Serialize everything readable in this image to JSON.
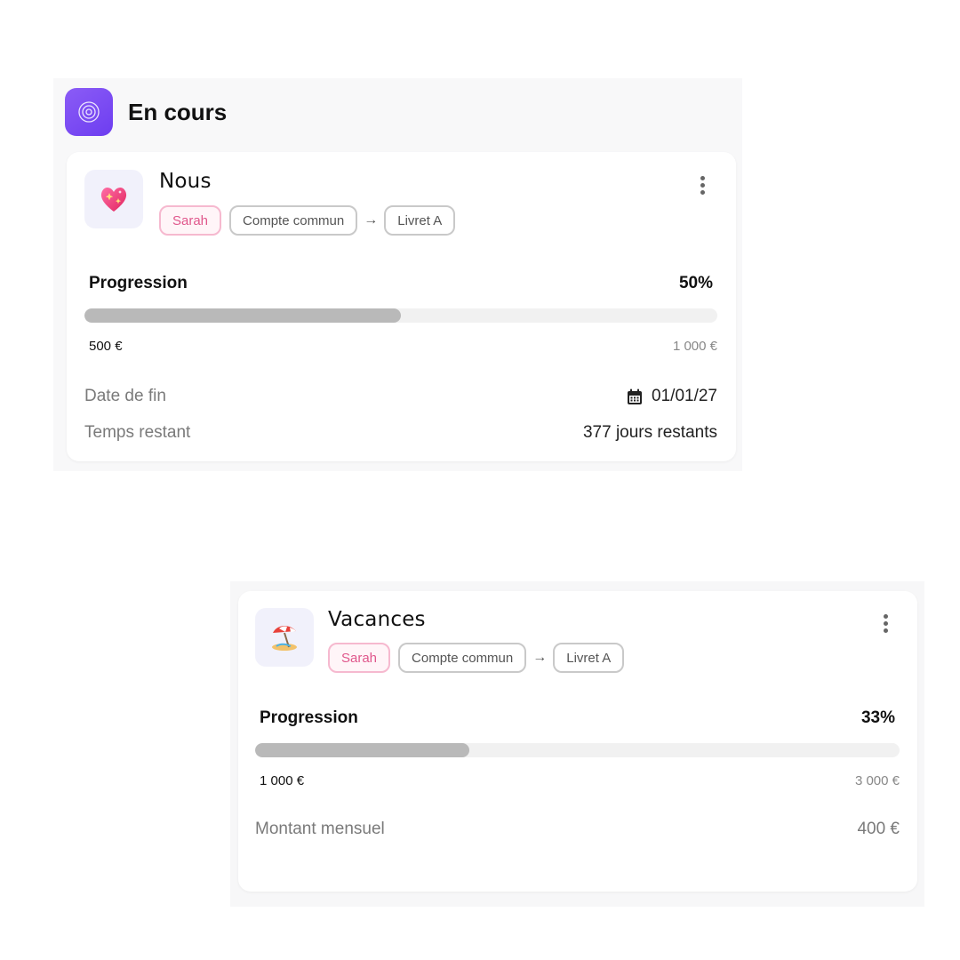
{
  "section": {
    "title": "En cours",
    "icon": "target-icon",
    "accent": "#7c4dff"
  },
  "goals": [
    {
      "emoji": "💖",
      "emoji_icon": "sparkling-heart-icon",
      "name": "Nous",
      "owner": "Sarah",
      "from_account": "Compte commun",
      "arrow": "→",
      "to_account": "Livret A",
      "progress_label": "Progression",
      "progress_pct_text": "50%",
      "progress": 0.5,
      "current_amount": "500 €",
      "target_amount": "1 000 €",
      "end_date_label": "Date de fin",
      "end_date_value": "01/01/27",
      "remaining_label": "Temps restant",
      "remaining_value": "377 jours restants"
    },
    {
      "emoji": "🏖️",
      "emoji_icon": "beach-umbrella-icon",
      "name": "Vacances",
      "owner": "Sarah",
      "from_account": "Compte commun",
      "arrow": "→",
      "to_account": "Livret A",
      "progress_label": "Progression",
      "progress_pct_text": "33%",
      "progress": 0.333,
      "current_amount": "1 000 €",
      "target_amount": "3 000 €",
      "monthly_label": "Montant mensuel",
      "monthly_value": "400 €"
    }
  ],
  "colors": {
    "owner_tag": "#e0578c",
    "bar_fill": "#b9b9b9",
    "bar_track": "#f1f1f1"
  }
}
